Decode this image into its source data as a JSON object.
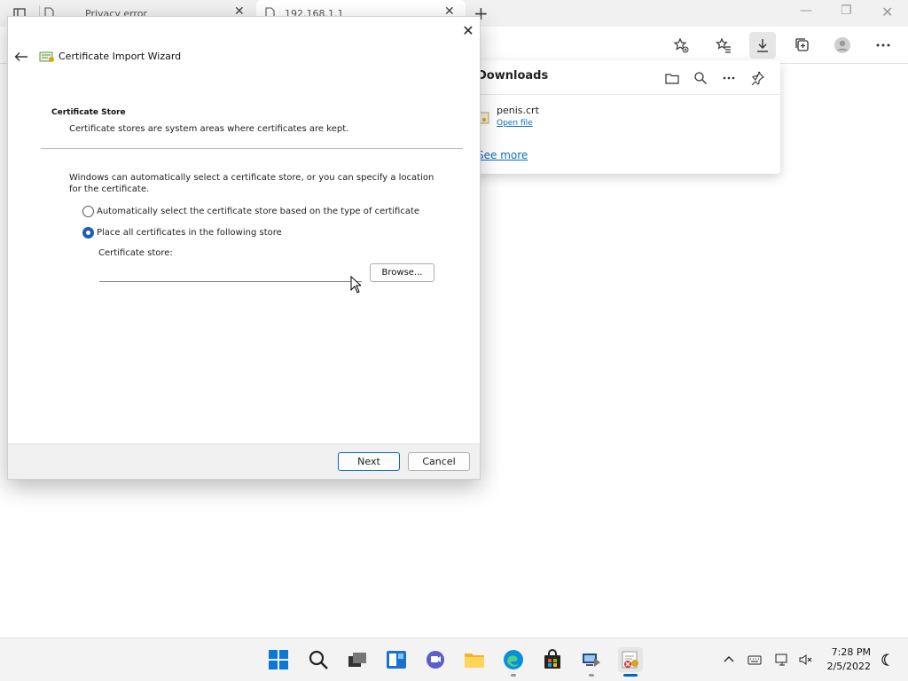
{
  "browser": {
    "tabs": [
      {
        "label": "Privacy error"
      },
      {
        "label": "192.168.1.1"
      }
    ]
  },
  "downloads": {
    "title": "Downloads",
    "item": {
      "filename": "penis.crt",
      "open_label": "Open file"
    },
    "see_more": "See more"
  },
  "wizard": {
    "title": "Certificate Import Wizard",
    "heading": "Certificate Store",
    "subheading": "Certificate stores are system areas where certificates are kept.",
    "description": "Windows can automatically select a certificate store, or you can specify a location for the certificate.",
    "options": [
      {
        "label": "Automatically select the certificate store based on the type of certificate",
        "selected": false
      },
      {
        "label": "Place all certificates in the following store",
        "selected": true
      }
    ],
    "store_label": "Certificate store:",
    "store_value": "",
    "browse_label": "Browse...",
    "next_label": "Next",
    "cancel_label": "Cancel"
  },
  "taskbar": {
    "time": "7:28 PM",
    "date": "2/5/2022"
  },
  "colors": {
    "accent": "#0067c0",
    "link": "#0a6cc6"
  }
}
